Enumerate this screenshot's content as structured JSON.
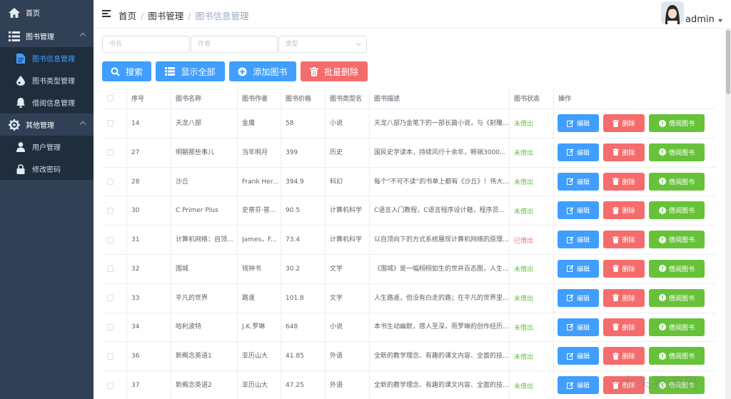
{
  "sidebar": {
    "home": "首页",
    "book_mgmt": "图书管理",
    "book_info": "图书信息管理",
    "book_type": "图书类型管理",
    "borrow_info": "借阅信息管理",
    "other_mgmt": "其他管理",
    "user_mgmt": "用户管理",
    "change_pwd": "修改密码"
  },
  "header": {
    "crumbs": [
      "首页",
      "图书管理",
      "图书信息管理"
    ],
    "username": "admin"
  },
  "search": {
    "name_placeholder": "书名",
    "author_placeholder": "作者",
    "type_placeholder": "类型"
  },
  "toolbar": {
    "search": "搜索",
    "show_all": "显示全部",
    "add": "添加图书",
    "batch_delete": "批量删除"
  },
  "table": {
    "columns": [
      "序号",
      "图书名称",
      "图书作者",
      "图书价格",
      "图书类型名",
      "图书描述",
      "图书状态",
      "操作"
    ],
    "actions": {
      "edit": "编辑",
      "delete": "删除",
      "borrow": "借阅图书"
    },
    "rows": [
      {
        "id": "14",
        "name": "天龙八部",
        "author": "金庸",
        "price": "58",
        "type": "小说",
        "desc": "天龙八部乃金笔下的一部长篇小说，与《射雕...",
        "status": "未借出",
        "borrowed": false
      },
      {
        "id": "27",
        "name": "明朝那些事儿",
        "author": "当年明月",
        "price": "399",
        "type": "历史",
        "desc": "国民史学读本，持续风行十余年，畅销3000...",
        "status": "未借出",
        "borrowed": false
      },
      {
        "id": "28",
        "name": "沙丘",
        "author": "Frank Her...",
        "price": "394.9",
        "type": "科幻",
        "desc": "每个“不可不读”的书单上都有《沙丘》！伟大...",
        "status": "未借出",
        "borrowed": false
      },
      {
        "id": "30",
        "name": "C Primer Plus",
        "author": "史蒂芬·普...",
        "price": "90.5",
        "type": "计算机科学",
        "desc": "C语言入门教程，C语言程序设计籍，程序员...",
        "status": "未借出",
        "borrowed": false
      },
      {
        "id": "31",
        "name": "计算机网络：自顶...",
        "author": "James，F...",
        "price": "73.4",
        "type": "计算机科学",
        "desc": "以自顶向下的方式系统展现计算机网络的原理...",
        "status": "已借出",
        "borrowed": true
      },
      {
        "id": "32",
        "name": "围城",
        "author": "钱钟书",
        "price": "30.2",
        "type": "文学",
        "desc": "《围城》是一幅栩栩如生的世井百态图，人生...",
        "status": "未借出",
        "borrowed": false
      },
      {
        "id": "33",
        "name": "平凡的世界",
        "author": "路遥",
        "price": "101.8",
        "type": "文学",
        "desc": "人生路遥，但没有白走的路；在平凡的世界里...",
        "status": "未借出",
        "borrowed": false
      },
      {
        "id": "34",
        "name": "哈利波特",
        "author": "J.K.罗琳",
        "price": "648",
        "type": "小说",
        "desc": "本书生动幽默，感人至深，而罗琳的创作经历...",
        "status": "未借出",
        "borrowed": false
      },
      {
        "id": "36",
        "name": "新概念英语1",
        "author": "亚历山大",
        "price": "41.85",
        "type": "外语",
        "desc": "全新的教学理念、有趣的课文内容、全面的技...",
        "status": "未借出",
        "borrowed": false
      },
      {
        "id": "37",
        "name": "新概念英语2",
        "author": "亚历山大",
        "price": "47.25",
        "type": "外语",
        "desc": "全新的教学理念、有趣的课文内容、全面的技...",
        "status": "未借出",
        "borrowed": false
      }
    ]
  },
  "watermark": "大头猿源码",
  "colors": {
    "primary": "#409eff",
    "danger": "#f56c6c",
    "success": "#67c23a",
    "sidebar": "#304156"
  }
}
